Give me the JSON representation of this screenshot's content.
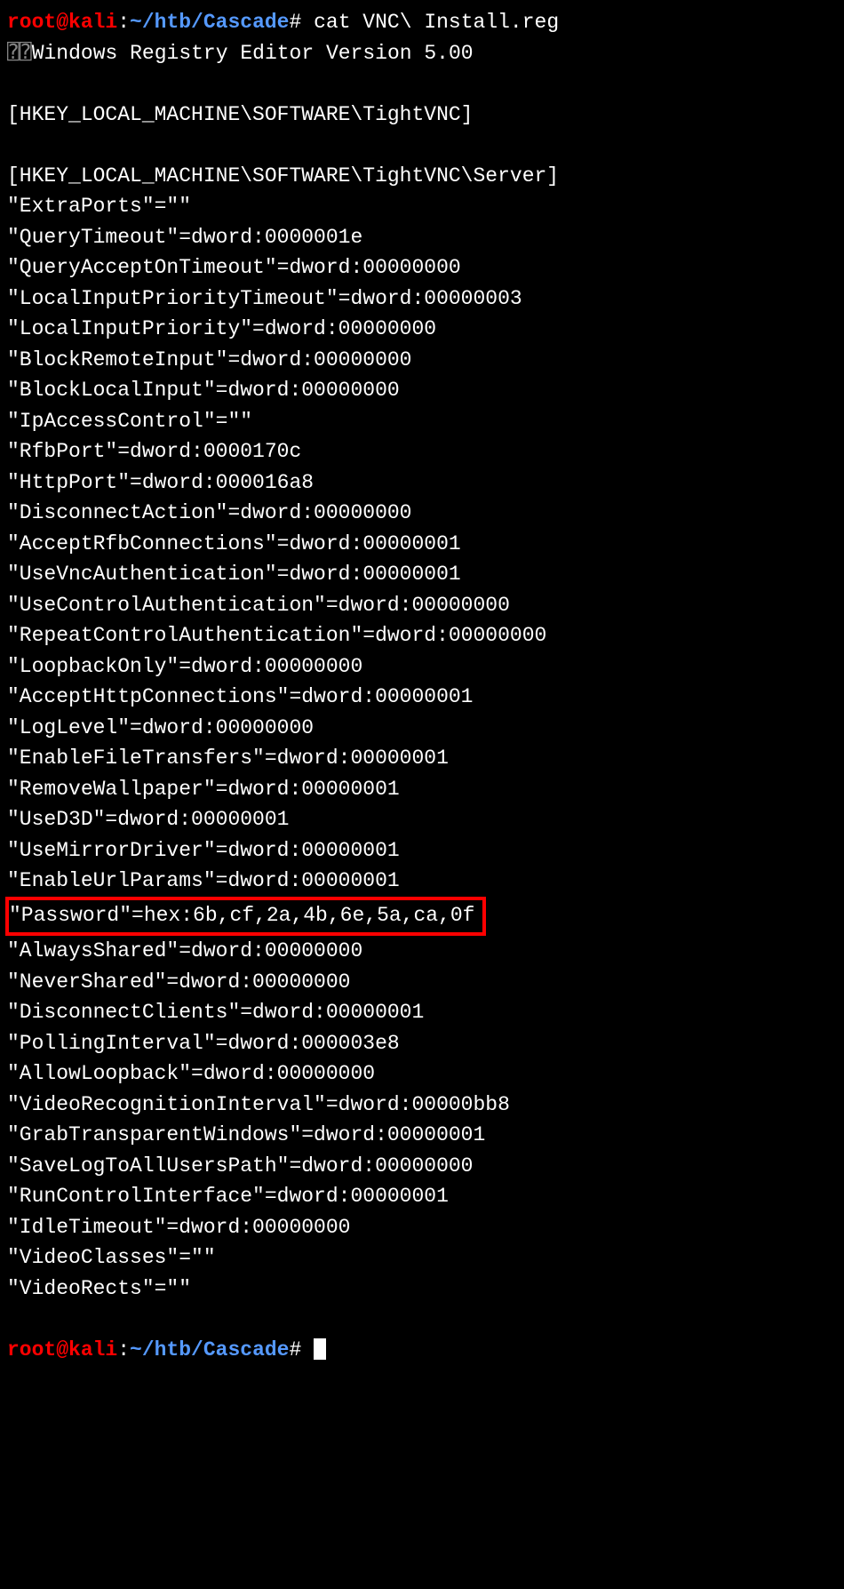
{
  "prompt1": {
    "user": "root@kali",
    "colon": ":",
    "path": "~/htb/Cascade",
    "hash": "#",
    "command": " cat VNC\\ Install.reg"
  },
  "garbled_prefix": "⍰⍰",
  "output": [
    "Windows Registry Editor Version 5.00",
    "",
    "[HKEY_LOCAL_MACHINE\\SOFTWARE\\TightVNC]",
    "",
    "[HKEY_LOCAL_MACHINE\\SOFTWARE\\TightVNC\\Server]",
    "\"ExtraPorts\"=\"\"",
    "\"QueryTimeout\"=dword:0000001e",
    "\"QueryAcceptOnTimeout\"=dword:00000000",
    "\"LocalInputPriorityTimeout\"=dword:00000003",
    "\"LocalInputPriority\"=dword:00000000",
    "\"BlockRemoteInput\"=dword:00000000",
    "\"BlockLocalInput\"=dword:00000000",
    "\"IpAccessControl\"=\"\"",
    "\"RfbPort\"=dword:0000170c",
    "\"HttpPort\"=dword:000016a8",
    "\"DisconnectAction\"=dword:00000000",
    "\"AcceptRfbConnections\"=dword:00000001",
    "\"UseVncAuthentication\"=dword:00000001",
    "\"UseControlAuthentication\"=dword:00000000",
    "\"RepeatControlAuthentication\"=dword:00000000",
    "\"LoopbackOnly\"=dword:00000000",
    "\"AcceptHttpConnections\"=dword:00000001",
    "\"LogLevel\"=dword:00000000",
    "\"EnableFileTransfers\"=dword:00000001",
    "\"RemoveWallpaper\"=dword:00000001",
    "\"UseD3D\"=dword:00000001",
    "\"UseMirrorDriver\"=dword:00000001",
    "\"EnableUrlParams\"=dword:00000001"
  ],
  "highlighted_line": "\"Password\"=hex:6b,cf,2a,4b,6e,5a,ca,0f",
  "output_after": [
    "\"AlwaysShared\"=dword:00000000",
    "\"NeverShared\"=dword:00000000",
    "\"DisconnectClients\"=dword:00000001",
    "\"PollingInterval\"=dword:000003e8",
    "\"AllowLoopback\"=dword:00000000",
    "\"VideoRecognitionInterval\"=dword:00000bb8",
    "\"GrabTransparentWindows\"=dword:00000001",
    "\"SaveLogToAllUsersPath\"=dword:00000000",
    "\"RunControlInterface\"=dword:00000001",
    "\"IdleTimeout\"=dword:00000000",
    "\"VideoClasses\"=\"\"",
    "\"VideoRects\"=\"\""
  ],
  "prompt2": {
    "user": "root@kali",
    "colon": ":",
    "path": "~/htb/Cascade",
    "hash": "#"
  }
}
